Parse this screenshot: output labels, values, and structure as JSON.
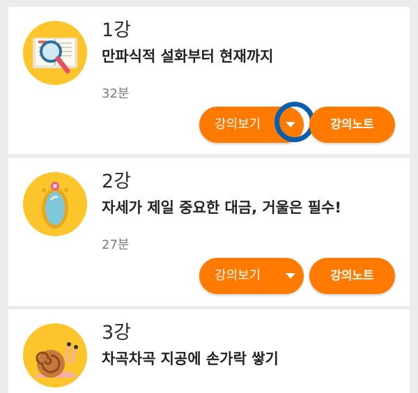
{
  "lectures": [
    {
      "number": "1강",
      "title": "만파식적 설화부터 현재까지",
      "duration": "32분",
      "thumbnail_icon": "book-magnifier-icon",
      "watch_label": "강의보기",
      "note_label": "강의노트"
    },
    {
      "number": "2강",
      "title": "자세가 제일 중요한 대금, 거울은 필수!",
      "duration": "27분",
      "thumbnail_icon": "mirror-icon",
      "watch_label": "강의보기",
      "note_label": "강의노트"
    },
    {
      "number": "3강",
      "title": "차곡차곡 지공에 손가락 쌓기",
      "thumbnail_icon": "snail-icon"
    }
  ],
  "colors": {
    "accent": "#ff7a00",
    "thumbnail_bg": "#fcc52c",
    "focus_ring": "#0a5fad",
    "background": "#ececec"
  }
}
